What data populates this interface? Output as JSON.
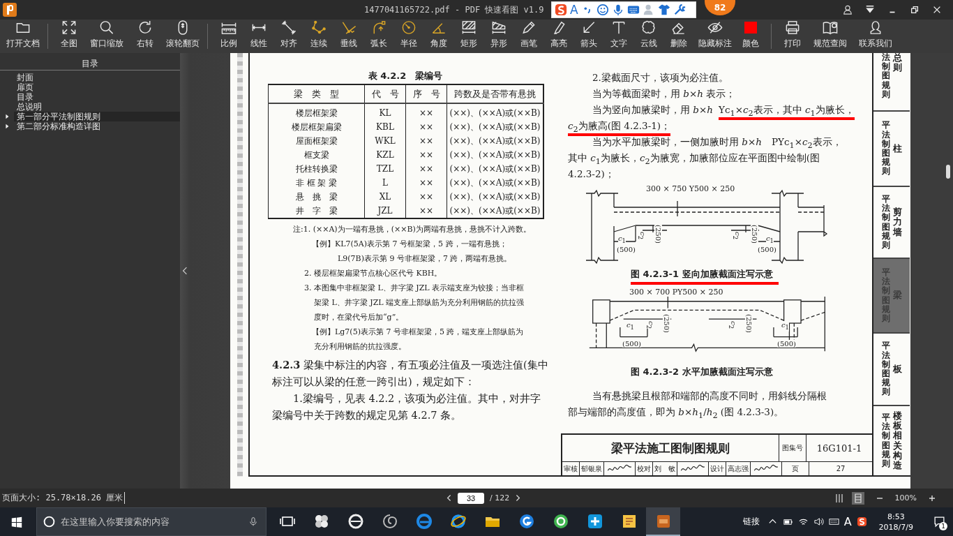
{
  "window": {
    "title": "1477041165722.pdf - PDF 快速看图 v1.9"
  },
  "notification_badge": "82",
  "ime_toolbar": {
    "mode": "A"
  },
  "toolbar": [
    {
      "tools": [
        {
          "label": "打开文档"
        }
      ]
    },
    {
      "tools": [
        {
          "label": "全图"
        },
        {
          "label": "窗口缩放"
        },
        {
          "label": "右转"
        },
        {
          "label": "滚轮翻页"
        }
      ]
    },
    {
      "tools": [
        {
          "label": "比例"
        },
        {
          "label": "线性"
        },
        {
          "label": "对齐"
        },
        {
          "label": "连续"
        },
        {
          "label": "垂线"
        },
        {
          "label": "弧长"
        },
        {
          "label": "半径"
        },
        {
          "label": "角度"
        },
        {
          "label": "矩形"
        },
        {
          "label": "异形"
        },
        {
          "label": "画笔"
        },
        {
          "label": "高亮"
        },
        {
          "label": "箭头"
        },
        {
          "label": "文字"
        },
        {
          "label": "云线"
        },
        {
          "label": "删除"
        },
        {
          "label": "隐藏标注"
        },
        {
          "label": "颜色",
          "color": "#ff0000"
        }
      ]
    },
    {
      "tools": [
        {
          "label": "打印"
        },
        {
          "label": "规范查阅"
        },
        {
          "label": "联系我们"
        }
      ]
    }
  ],
  "sidebar": {
    "title": "目录",
    "items": [
      {
        "label": "封面",
        "selected": false
      },
      {
        "label": "扉页",
        "selected": false
      },
      {
        "label": "目录",
        "selected": false
      },
      {
        "label": "总说明",
        "selected": false
      },
      {
        "label": "第一部分平法制图规则",
        "selected": true,
        "expanded": false
      },
      {
        "label": "第二部分标准构造详图",
        "selected": false,
        "expanded": false
      }
    ]
  },
  "page": {
    "table": {
      "caption": "表 4.2.2　梁编号",
      "columns": [
        "梁　类　型",
        "代　号",
        "序　号",
        "跨数及是否带有悬挑"
      ],
      "rows": [
        [
          "楼层框架梁",
          "KL",
          "××",
          "(××)、(××A)或(××B)"
        ],
        [
          "楼层框架扁梁",
          "KBL",
          "××",
          "(××)、(××A)或(××B)"
        ],
        [
          "屋面框架梁",
          "WKL",
          "××",
          "(××)、(××A)或(××B)"
        ],
        [
          "框支梁",
          "KZL",
          "××",
          "(××)、(××A)或(××B)"
        ],
        [
          "托柱转换梁",
          "TZL",
          "××",
          "(××)、(××A)或(××B)"
        ],
        [
          "非 框 架 梁",
          "L",
          "××",
          "(××)、(××A)或(××B)"
        ],
        [
          "悬　挑　梁",
          "XL",
          "××",
          "(××)、(××A)或(××B)"
        ],
        [
          "井　字　梁",
          "JZL",
          "××",
          "(××)、(××A)或(××B)"
        ]
      ]
    },
    "notes": [
      {
        "kind": "head",
        "text": "注:1. (××A)为一端有悬挑，(××B)为两端有悬挑，悬挑不计入跨数。"
      },
      {
        "kind": "example",
        "text": "【例】KL7(5A)表示第 7 号框架梁，5 跨，一端有悬挑；"
      },
      {
        "kind": "example_cont",
        "text": "L9(7B)表示第 9 号非框架梁，7 跨，两端有悬挑。"
      },
      {
        "kind": "item",
        "text": "2.  楼层框架扁梁节点核心区代号 KBH。"
      },
      {
        "kind": "item",
        "text": "3. 本图集中非框架梁 L、井字梁 JZL 表示端支座为铰接；当非框"
      },
      {
        "kind": "wrap",
        "text": "架梁 L、井字梁 JZL 端支座上部纵筋为充分利用钢筋的抗拉强"
      },
      {
        "kind": "wrap",
        "text": "度时，在梁代号后加“g”。"
      },
      {
        "kind": "example",
        "text": "【例】Lg7(5)表示第 7 号非框架梁，5 跨，端支座上部纵筋为"
      },
      {
        "kind": "wrap",
        "text": "充分利用钢筋的抗拉强度。"
      }
    ],
    "body": [
      {
        "kind": "body",
        "text": "**4.2.3** 梁集中标注的内容，有五项必注值及一项选注值(集中"
      },
      {
        "kind": "body",
        "text": "标注可以从梁的任意一跨引出)，规定如下："
      },
      {
        "kind": "indent",
        "text": "1.梁编号，见表 4.2.2，该项为必注值。其中，对井字"
      },
      {
        "kind": "body",
        "text": "梁编号中关于跨数的规定见第 4.2.7 条。"
      }
    ],
    "right": {
      "lines_before": [
        {
          "kind": "indent",
          "parts": [
            {
              "text": "2.梁截面尺寸，该项为必注值。",
              "marked": false
            }
          ]
        },
        {
          "kind": "indent",
          "parts": [
            {
              "text": "当为等截面梁时，用 *b*×*h* 表示；",
              "marked": false
            }
          ]
        },
        {
          "kind": "indent",
          "parts": [
            {
              "text": "当为竖向加腋梁时，用 *b*×*h*",
              "marked": false
            },
            {
              "text": "Yc$_{1}$×*c*$_{2}$表示，其中 *c*$_{1}$为腋长，",
              "marked": true
            }
          ]
        },
        {
          "kind": "body",
          "parts": [
            {
              "text": "*c*$_{2}$为腋高(图 4.2.3-1)；",
              "marked": true
            }
          ]
        },
        {
          "kind": "indent",
          "parts": [
            {
              "text": "当为水平加腋梁时，一侧加腋时用 *b*×*h*　PYc$_{1}$×*c*$_{2}$表示，",
              "marked": false
            }
          ]
        },
        {
          "kind": "body",
          "parts": [
            {
              "text": "其中 *c*$_{1}$为腋长，*c*$_{2}$为腋宽，加腋部位应在平面图中绘制(图",
              "marked": false
            }
          ]
        },
        {
          "kind": "body",
          "parts": [
            {
              "text": "4.2.3-2)；",
              "marked": false
            }
          ]
        }
      ],
      "figures": [
        {
          "kind": "vertical",
          "label": "300 × 750  Y500 × 250",
          "dims": [
            "*c*$_{1}$",
            "*c*$_{2}$",
            "(250)",
            "*c*$_{2}$",
            "(250)",
            "*c*$_{1}$",
            "(500)",
            "(500)"
          ],
          "caption": "图 4.2.3-1  竖向加腋截面注写示意",
          "marked": true
        },
        {
          "kind": "horizontal",
          "label": "300 × 700  PY500 × 250",
          "dims": [
            "*c*$_{1}$",
            "*c*$_{2}$",
            "(250)",
            "*c*$_{2}$",
            "(250)",
            "*c*$_{1}$",
            "(500)",
            "(500)"
          ],
          "caption": "图 4.2.3-2  水平加腋截面注写示意",
          "marked": false
        }
      ],
      "lines_after": [
        {
          "kind": "indent",
          "parts": [
            {
              "text": "当有悬挑梁且根部和端部的高度不同时，用斜线分隔根",
              "marked": false
            }
          ]
        },
        {
          "kind": "body",
          "parts": [
            {
              "text": "部与端部的高度值，即为 *b*×*h*$_{1}$/*h*$_{2}$ (图 4.2.3-3)。",
              "marked": false
            }
          ]
        }
      ]
    },
    "title_block": {
      "title": "梁平法施工图制图规则",
      "atlas_label": "图集号",
      "atlas_no": "16G101-1",
      "people": [
        {
          "role": "审核",
          "name": "郁银泉"
        },
        {
          "role": "校对",
          "name": "刘　敏"
        },
        {
          "role": "设计",
          "name": "高志强"
        }
      ],
      "page_label": "页",
      "page_no": "27"
    },
    "tabs": [
      {
        "prefix": "法制图规则",
        "label": "总则",
        "selected": false
      },
      {
        "prefix": "平法制图规则",
        "label": "柱",
        "selected": false
      },
      {
        "prefix": "平法制图规则",
        "label": "剪力墙",
        "selected": false
      },
      {
        "prefix": "平法制图规则",
        "label": "梁",
        "selected": true
      },
      {
        "prefix": "平法制图规则",
        "label": "板",
        "selected": false
      },
      {
        "prefix": "平法制图规则",
        "label": "楼板相关构造",
        "selected": false
      }
    ]
  },
  "status_bar": {
    "page_size": "页面大小: 25.78×18.26 厘米",
    "current_page": "33",
    "total": "/ 122",
    "view_modes": [
      {
        "selected": false
      },
      {
        "selected": true
      }
    ],
    "zoom": "100%"
  },
  "taskbar": {
    "search_placeholder": "在这里输入你要搜索的内容",
    "apps": [
      {
        "selected": false
      },
      {
        "selected": false
      },
      {
        "selected": false
      },
      {
        "selected": false
      },
      {
        "selected": false
      },
      {
        "selected": false
      },
      {
        "selected": false
      },
      {
        "selected": false
      },
      {
        "selected": false
      },
      {
        "selected": false
      },
      {
        "selected": false
      },
      {
        "selected": true
      }
    ],
    "links": "链接",
    "ime": "A",
    "time": "8:53",
    "date": "2018/7/9",
    "notifications": "1"
  }
}
